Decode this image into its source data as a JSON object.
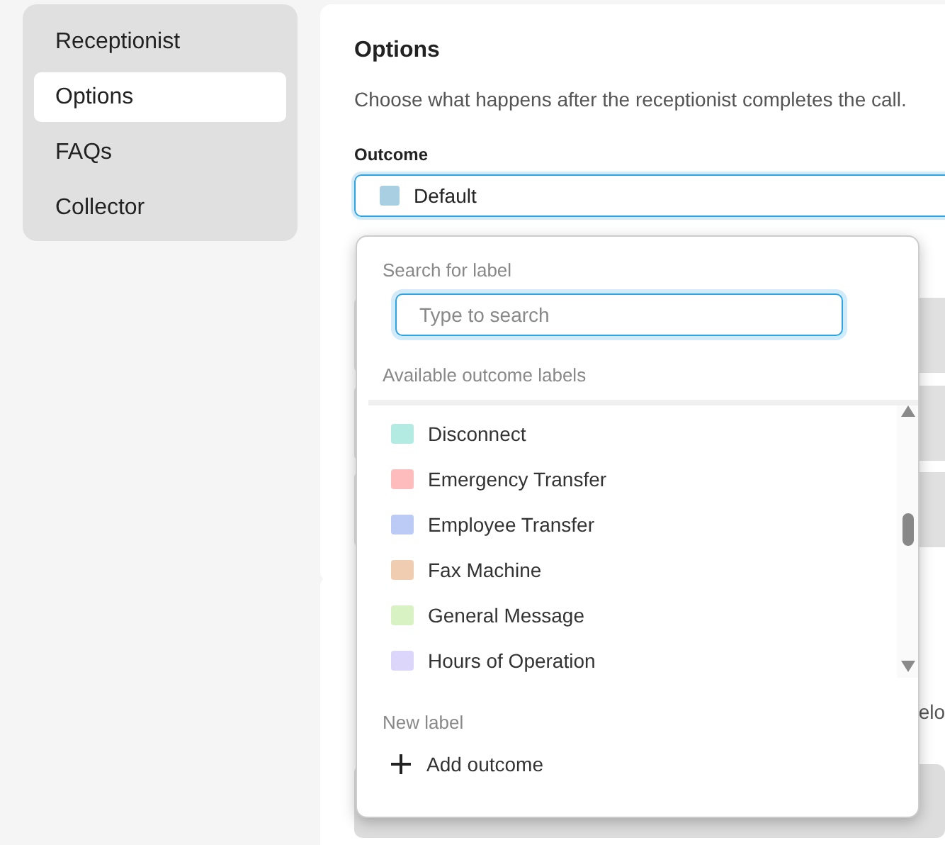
{
  "sidebar": {
    "items": [
      {
        "label": "Receptionist",
        "selected": false
      },
      {
        "label": "Options",
        "selected": true
      },
      {
        "label": "FAQs",
        "selected": false
      },
      {
        "label": "Collector",
        "selected": false
      }
    ]
  },
  "options_card": {
    "title": "Options",
    "description": "Choose what happens after the receptionist completes the call.",
    "outcome_label": "Outcome",
    "outcome_value": {
      "label": "Default",
      "color": "#a9cfe3"
    }
  },
  "second_card": {
    "partial_text": "elo"
  },
  "dropdown": {
    "search_label": "Search for label",
    "search": {
      "placeholder": "Type to search"
    },
    "list_label": "Available outcome labels",
    "labels": [
      {
        "label": "Disconnect",
        "color": "#b3ebe3"
      },
      {
        "label": "Emergency Transfer",
        "color": "#ffbcbc"
      },
      {
        "label": "Employee Transfer",
        "color": "#bccbf6"
      },
      {
        "label": "Fax Machine",
        "color": "#f0cdb0"
      },
      {
        "label": "General Message",
        "color": "#d9f2c4"
      },
      {
        "label": "Hours of Operation",
        "color": "#ddd6fb"
      }
    ],
    "new_label": "New label",
    "add_button": "Add outcome"
  }
}
